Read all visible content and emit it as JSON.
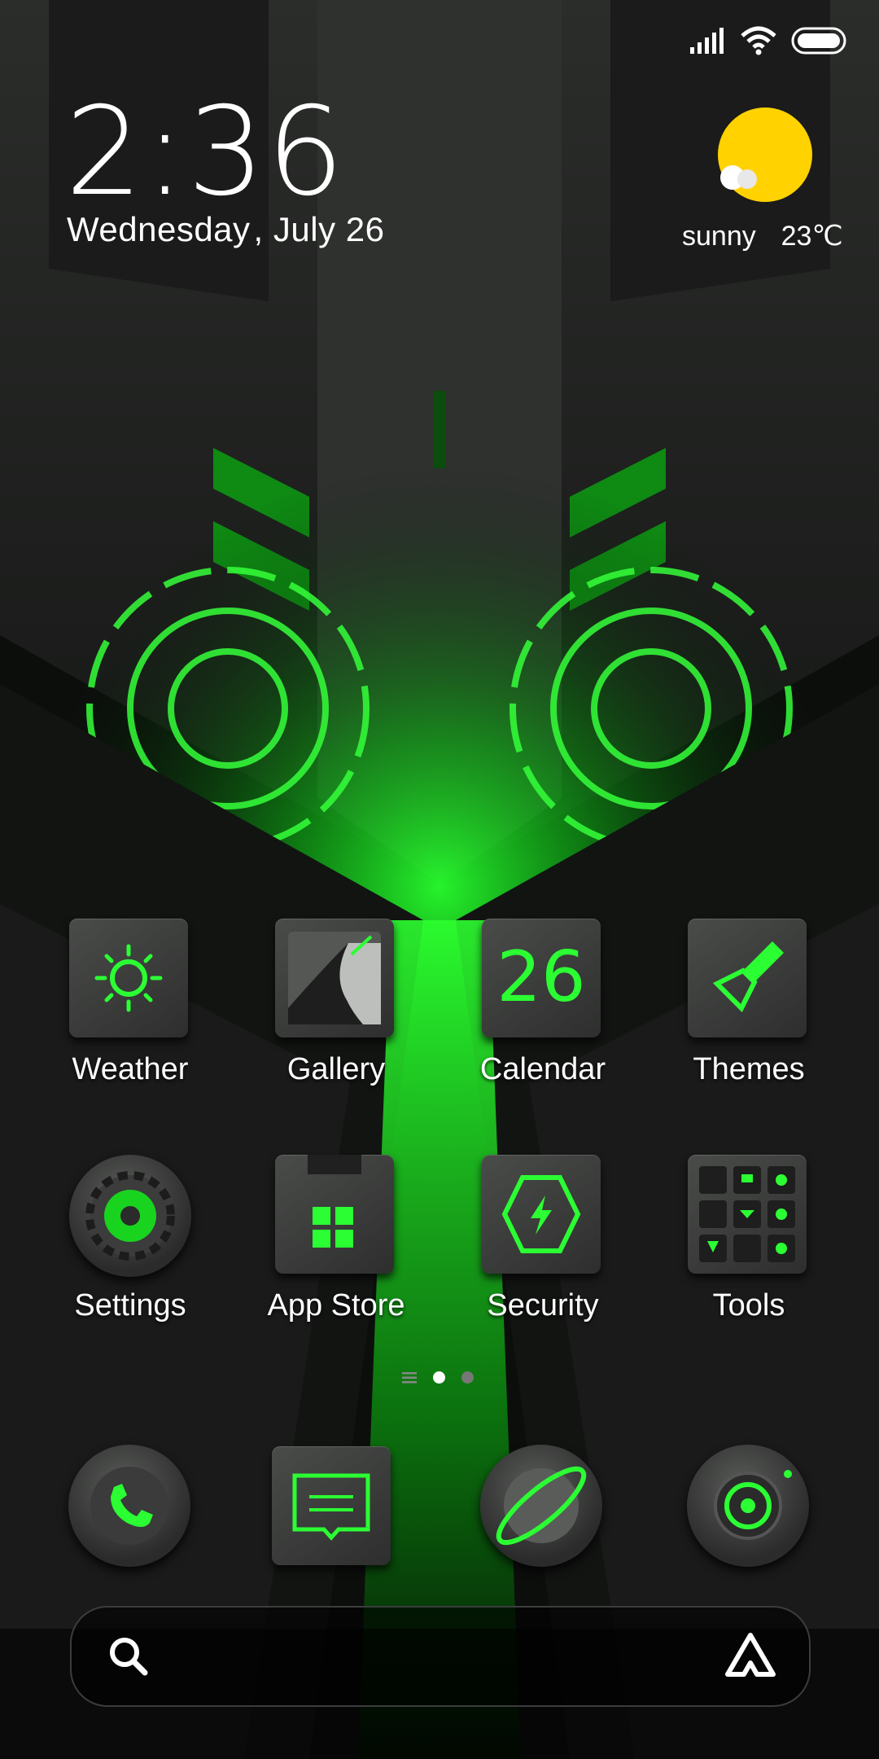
{
  "status_bar": {
    "icons": [
      "signal-icon",
      "wifi-icon",
      "battery-icon"
    ]
  },
  "lock": {
    "time": "2:36",
    "date": "Wednesday , July 26"
  },
  "weather_widget": {
    "condition": "sunny",
    "temperature": "23℃",
    "icon": "sun-cloud-icon"
  },
  "apps": [
    {
      "label": "Weather",
      "icon": "sun-icon"
    },
    {
      "label": "Gallery",
      "icon": "gallery-icon"
    },
    {
      "label": "Calendar",
      "icon": "calendar-icon",
      "badge": "26"
    },
    {
      "label": "Themes",
      "icon": "brush-icon"
    },
    {
      "label": "Settings",
      "icon": "gear-icon"
    },
    {
      "label": "App Store",
      "icon": "store-icon"
    },
    {
      "label": "Security",
      "icon": "shield-icon"
    },
    {
      "label": "Tools",
      "icon": "tools-folder-icon"
    }
  ],
  "dock": [
    {
      "icon": "phone-icon"
    },
    {
      "icon": "message-icon"
    },
    {
      "icon": "browser-icon"
    },
    {
      "icon": "camera-icon"
    }
  ],
  "page_indicator": {
    "pages": 2,
    "current": 1
  },
  "search_bar": {
    "left_icon": "search-icon",
    "right_icon": "assistant-icon"
  },
  "colors": {
    "accent": "#1ee82a",
    "sun": "#ffd200",
    "tile": "#3b3c3b"
  }
}
